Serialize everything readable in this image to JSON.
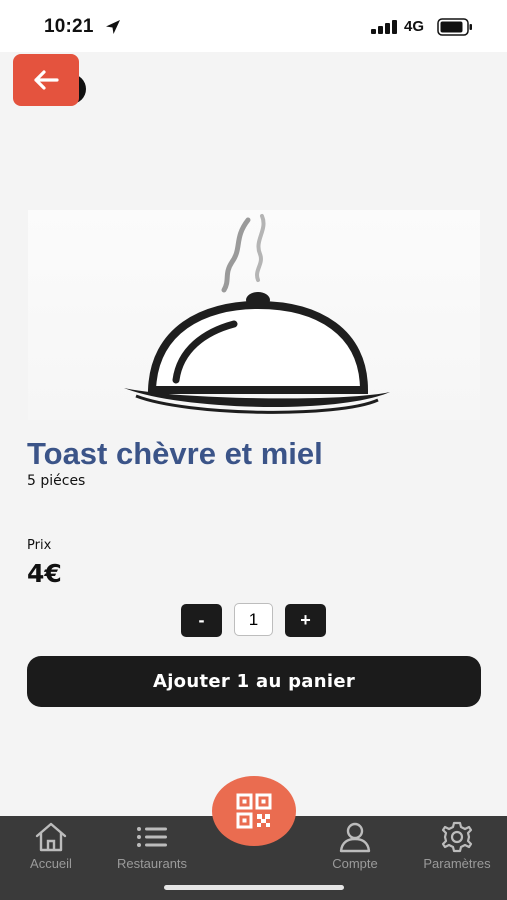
{
  "status_bar": {
    "time": "10:21",
    "network": "4G"
  },
  "product": {
    "name": "Toast chèvre et miel",
    "description": "5 piéces",
    "price_label": "Prix",
    "price": "4€",
    "image_icon": "cloche-icon"
  },
  "quantity": {
    "minus_label": "-",
    "plus_label": "+",
    "value": "1"
  },
  "add_to_cart": {
    "label": "Ajouter 1 au panier"
  },
  "tab_bar": {
    "items": [
      {
        "label": "Accueil",
        "icon": "home-icon"
      },
      {
        "label": "Restaurants",
        "icon": "list-icon"
      },
      {
        "label": "Compte",
        "icon": "user-icon"
      },
      {
        "label": "Paramètres",
        "icon": "gear-icon"
      }
    ],
    "center_button_icon": "qr-code-icon"
  },
  "colors": {
    "accent": "#e4533e",
    "fab": "#ea6c50",
    "title": "#3b5488",
    "dark_button": "#1b1b1b",
    "tab_bar": "#3a3a3a"
  }
}
